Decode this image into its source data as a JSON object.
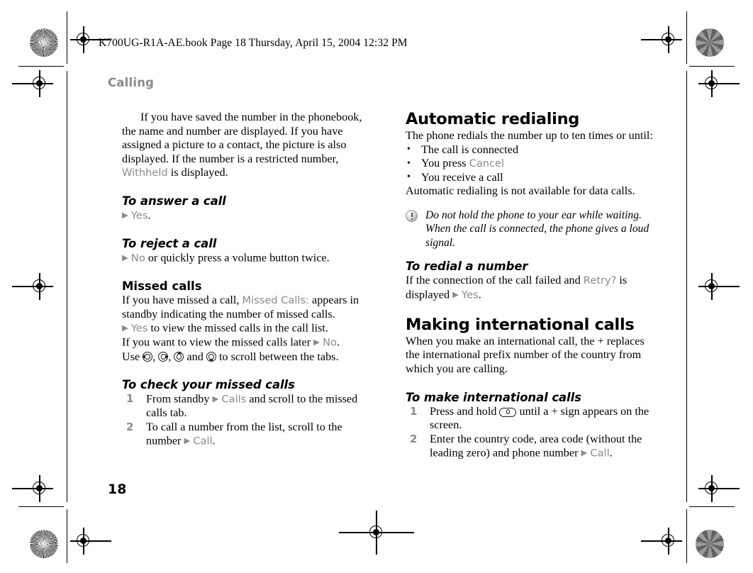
{
  "printer_header": {
    "filename_line": "K700UG-R1A-AE.book  Page 18  Thursday, April 15, 2004  12:32 PM"
  },
  "chapter": {
    "running_head": "Calling"
  },
  "folio": {
    "page_number": "18"
  },
  "left_column": {
    "intro_paragraph": {
      "part1": "If you have saved the number in the phonebook, the name and number are displayed. If you have assigned a picture to a contact, the picture is also displayed. If the number is a restricted number, ",
      "ui_withheld": "Withheld",
      "part2": " is displayed."
    },
    "answer_section": {
      "heading": "To answer a call",
      "arrow": "▶",
      "ui_yes": "Yes",
      "period": "."
    },
    "reject_section": {
      "heading": "To reject a call",
      "arrow": "▶",
      "ui_no": "No",
      "rest": " or quickly press a volume button twice."
    },
    "missed_calls_section": {
      "heading": "Missed calls",
      "line1_pre": "If you have missed a call, ",
      "line1_ui": "Missed Calls:",
      "line1_post": " appears in standby indicating the number of missed calls.",
      "line2_arrow": "▶",
      "line2_ui": "Yes",
      "line2_post": " to view the missed calls in the call list.",
      "line3_pre": "If you want to view the missed calls later ",
      "line3_arrow": "▶",
      "line3_ui": "No",
      "line3_post": ".",
      "line4_pre": "Use ",
      "line4_sep1": ", ",
      "line4_sep2": ", ",
      "line4_and": " and ",
      "line4_post": " to scroll between the tabs.",
      "nav_keys": [
        "nav-key-left",
        "nav-key-right",
        "nav-key-up",
        "nav-key-down"
      ]
    },
    "check_missed_section": {
      "heading": "To check your missed calls",
      "steps": [
        {
          "pre": "From standby ",
          "arrow": "▶",
          "ui": "Calls",
          "post": " and scroll to the missed calls tab."
        },
        {
          "pre": "To call a number from the list, scroll to the number ",
          "arrow": "▶",
          "ui": "Call",
          "post": "."
        }
      ]
    }
  },
  "right_column": {
    "automatic_redialing": {
      "heading": "Automatic redialing",
      "intro": "The phone redials the number up to ten times or until:",
      "bullets": [
        {
          "pre": "The call is connected",
          "ui": "",
          "post": ""
        },
        {
          "pre": "You press ",
          "ui": "Cancel",
          "post": ""
        },
        {
          "pre": "You receive a call",
          "ui": "",
          "post": ""
        }
      ],
      "outro": "Automatic redialing is not available for data calls."
    },
    "note": {
      "icon": "caution-icon",
      "text": "Do not hold the phone to your ear while waiting. When the call is connected, the phone gives a loud signal."
    },
    "redial_section": {
      "heading": "To redial a number",
      "pre": "If the connection of the call failed and ",
      "ui_retry": "Retry?",
      "mid": " is displayed ",
      "arrow": "▶",
      "ui_yes": "Yes",
      "post": "."
    },
    "international_section": {
      "heading": "Making international calls",
      "body": "When you make an international call, the + replaces the international prefix number of the country from which you are calling."
    },
    "make_international_section": {
      "heading": "To make international calls",
      "steps": [
        {
          "pre": "Press and hold ",
          "key": "0",
          "post": " until a + sign appears on the screen.",
          "arrow": "",
          "ui": ""
        },
        {
          "pre": "Enter the country code, area code (without the leading zero) and phone number ",
          "arrow": "▶",
          "ui": "Call",
          "post": "."
        }
      ]
    }
  },
  "colors": {
    "ui_keyword": "#8b8b8b",
    "chapter_head": "#8b8b8b",
    "text": "#000000",
    "page_background": "#ffffff"
  }
}
